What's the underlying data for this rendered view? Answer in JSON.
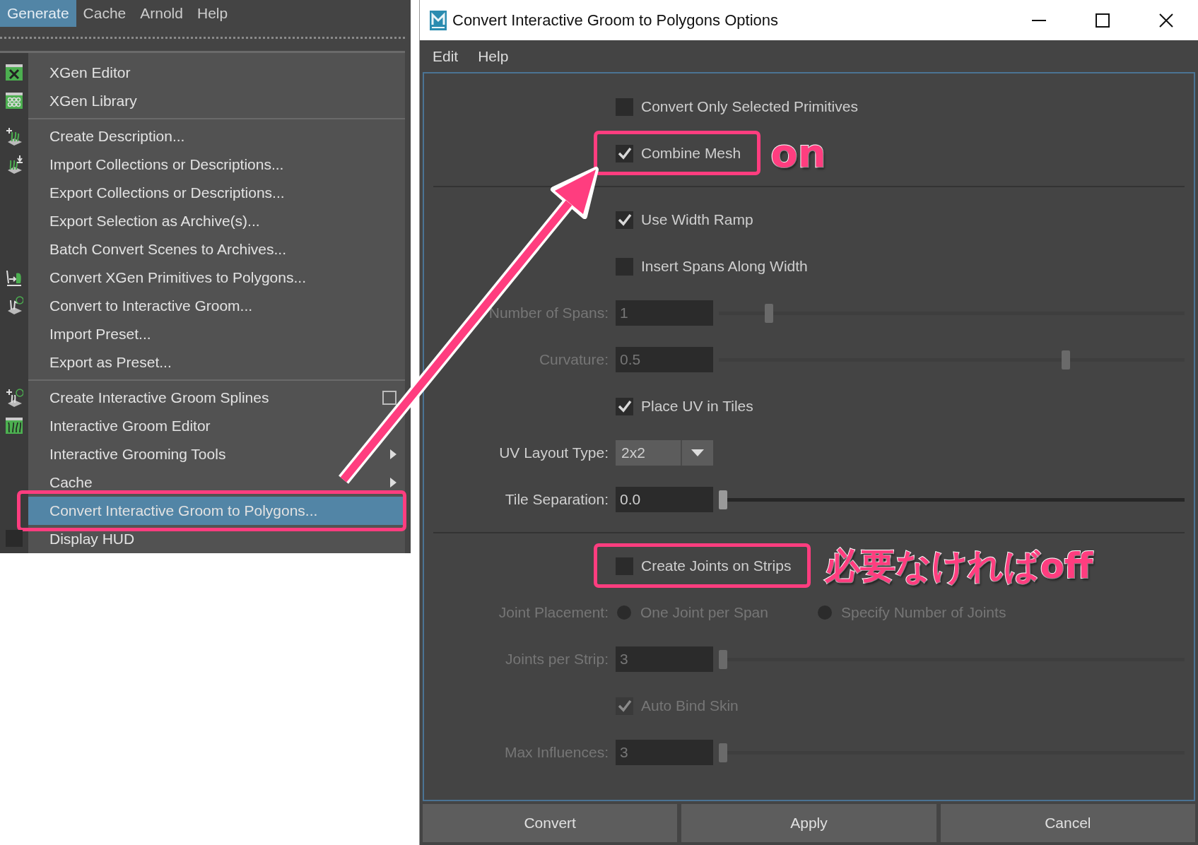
{
  "main_menu": [
    {
      "label": "Generate",
      "selected": true
    },
    {
      "label": "Cache",
      "selected": false
    },
    {
      "label": "Arnold",
      "selected": false
    },
    {
      "label": "Help",
      "selected": false
    }
  ],
  "menu": {
    "items": [
      {
        "kind": "item",
        "label": "XGen Editor",
        "submenu": false,
        "option_box": false,
        "selected": false,
        "highlighted": false
      },
      {
        "kind": "item",
        "label": "XGen Library",
        "submenu": false,
        "option_box": false,
        "selected": false,
        "highlighted": false
      },
      {
        "kind": "separator"
      },
      {
        "kind": "item",
        "label": "Create Description...",
        "submenu": false,
        "option_box": false,
        "selected": false,
        "highlighted": false
      },
      {
        "kind": "item",
        "label": "Import Collections or Descriptions...",
        "submenu": false,
        "option_box": false,
        "selected": false,
        "highlighted": false
      },
      {
        "kind": "item",
        "label": "Export Collections or Descriptions...",
        "submenu": false,
        "option_box": false,
        "selected": false,
        "highlighted": false
      },
      {
        "kind": "item",
        "label": "Export Selection as Archive(s)...",
        "submenu": false,
        "option_box": false,
        "selected": false,
        "highlighted": false
      },
      {
        "kind": "item",
        "label": "Batch Convert Scenes to Archives...",
        "submenu": false,
        "option_box": false,
        "selected": false,
        "highlighted": false
      },
      {
        "kind": "item",
        "label": "Convert XGen Primitives to Polygons...",
        "submenu": false,
        "option_box": false,
        "selected": false,
        "highlighted": false
      },
      {
        "kind": "item",
        "label": "Convert to Interactive Groom...",
        "submenu": false,
        "option_box": false,
        "selected": false,
        "highlighted": false
      },
      {
        "kind": "item",
        "label": "Import Preset...",
        "submenu": false,
        "option_box": false,
        "selected": false,
        "highlighted": false
      },
      {
        "kind": "item",
        "label": "Export as Preset...",
        "submenu": false,
        "option_box": false,
        "selected": false,
        "highlighted": false
      },
      {
        "kind": "separator"
      },
      {
        "kind": "item",
        "label": "Create Interactive Groom Splines",
        "submenu": false,
        "option_box": true,
        "selected": false,
        "highlighted": false
      },
      {
        "kind": "item",
        "label": "Interactive Groom Editor",
        "submenu": false,
        "option_box": false,
        "selected": false,
        "highlighted": false
      },
      {
        "kind": "item",
        "label": "Interactive Grooming Tools",
        "submenu": true,
        "option_box": false,
        "selected": false,
        "highlighted": false
      },
      {
        "kind": "item",
        "label": "Cache",
        "submenu": true,
        "option_box": false,
        "selected": false,
        "highlighted": false
      },
      {
        "kind": "item",
        "label": "Convert Interactive Groom to Polygons...",
        "submenu": false,
        "option_box": false,
        "selected": true,
        "highlighted": true
      },
      {
        "kind": "item",
        "label": "Display HUD",
        "submenu": false,
        "option_box": false,
        "selected": false,
        "highlighted": false
      }
    ]
  },
  "dialog": {
    "title": "Convert Interactive Groom to Polygons Options",
    "menu": [
      "Edit",
      "Help"
    ],
    "options": [
      {
        "kind": "checkbox",
        "label": "Convert Only Selected Primitives",
        "checked": false,
        "disabled": false,
        "highlighted": false
      },
      {
        "kind": "checkbox",
        "label": "Combine Mesh",
        "checked": true,
        "disabled": false,
        "highlighted": true,
        "note": "on"
      },
      {
        "kind": "separator"
      },
      {
        "kind": "checkbox",
        "label": "Use Width Ramp",
        "checked": true,
        "disabled": false,
        "highlighted": false
      },
      {
        "kind": "checkbox",
        "label": "Insert Spans Along Width",
        "checked": false,
        "disabled": false,
        "highlighted": false
      },
      {
        "kind": "slider",
        "label": "Number of Spans:",
        "value": "1",
        "level": 0.1,
        "disabled": true
      },
      {
        "kind": "slider",
        "label": "Curvature:",
        "value": "0.5",
        "level": 0.75,
        "disabled": true
      },
      {
        "kind": "checkbox",
        "label": "Place UV in Tiles",
        "checked": true,
        "disabled": false,
        "highlighted": false
      },
      {
        "kind": "dropdown",
        "label": "UV Layout Type:",
        "value": "2x2",
        "disabled": false
      },
      {
        "kind": "slider",
        "label": "Tile Separation:",
        "value": "0.0",
        "level": 0,
        "disabled": false
      },
      {
        "kind": "separator"
      },
      {
        "kind": "checkbox",
        "label": "Create Joints on Strips",
        "checked": false,
        "disabled": false,
        "highlighted": true,
        "note": "必要なければoff"
      },
      {
        "kind": "radio",
        "label": "Joint Placement:",
        "disabled": true,
        "options": [
          {
            "label": "One Joint per Span",
            "selected": false
          },
          {
            "label": "Specify Number of Joints",
            "selected": false
          }
        ]
      },
      {
        "kind": "slider",
        "label": "Joints per Strip:",
        "value": "3",
        "level": 0,
        "disabled": true
      },
      {
        "kind": "checkbox",
        "label": "Auto Bind Skin",
        "checked": true,
        "disabled": true,
        "highlighted": false
      },
      {
        "kind": "slider",
        "label": "Max Influences:",
        "value": "3",
        "level": 0,
        "disabled": true
      }
    ],
    "buttons": [
      "Convert",
      "Apply",
      "Cancel"
    ]
  }
}
